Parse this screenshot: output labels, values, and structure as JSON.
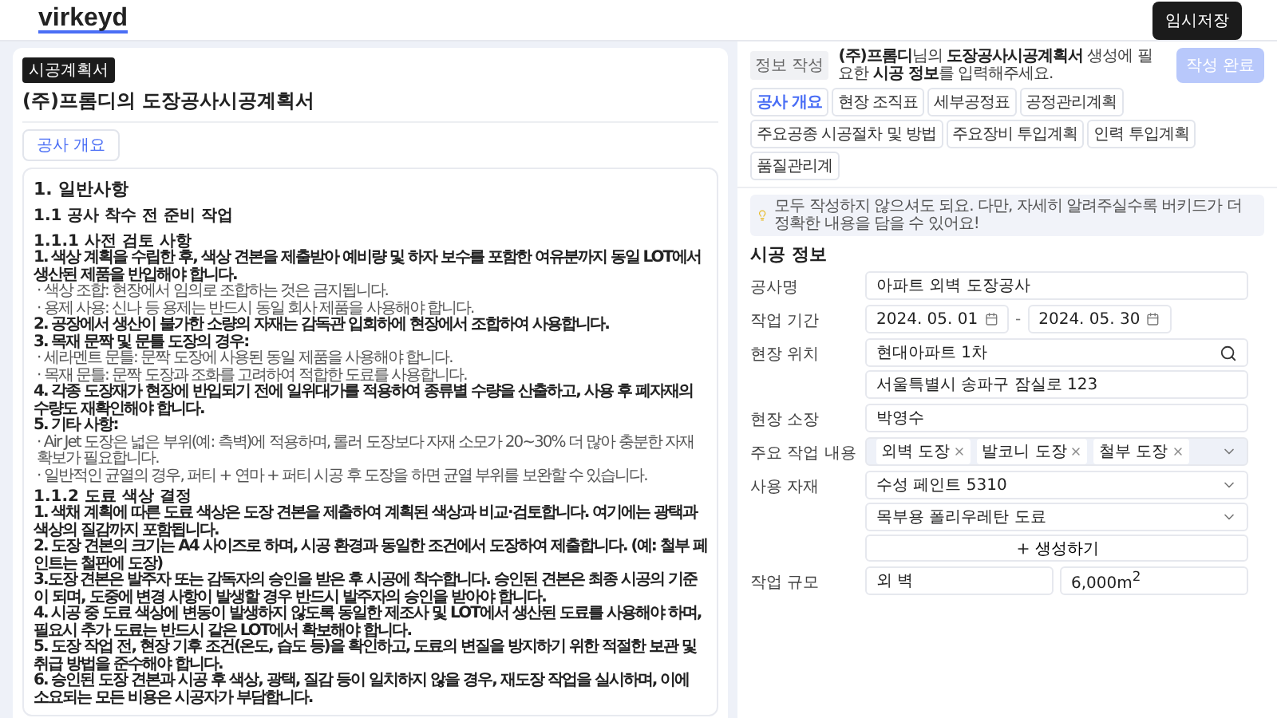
{
  "header": {
    "logo": "virkeyd",
    "save_button": "임시저장"
  },
  "document": {
    "badge": "시공계획서",
    "title": "(주)프롬디의 도장공사시공계획서",
    "section_button": "공사 개요",
    "heading": "1. 일반사항",
    "subheading": "1.1 공사 착수 전 준비 작업",
    "blocks": [
      {
        "title": "1.1.1 사전 검토 사항",
        "lines": [
          {
            "kind": "main",
            "text": "1. 색상 계획을 수립한 후, 색상 견본을 제출받아 예비량 및 하자 보수를 포함한 여유분까지 동일 LOT에서 생산된 제품을 반입해야 합니다."
          },
          {
            "kind": "sub",
            "text": "· 색상 조합: 현장에서 임의로 조합하는 것은 금지됩니다."
          },
          {
            "kind": "sub",
            "text": "· 용제 사용: 신나 등 용제는 반드시 동일 회사 제품을 사용해야 합니다."
          },
          {
            "kind": "main",
            "text": "2. 공장에서 생산이 불가한 소량의 자재는 감독관 입회하에 현장에서 조합하여 사용합니다."
          },
          {
            "kind": "main",
            "text": "3. 목재 문짝 및 문틀 도장의 경우:"
          },
          {
            "kind": "sub",
            "text": "· 세라멘트 문틀: 문짝 도장에 사용된 동일 제품을 사용해야 합니다."
          },
          {
            "kind": "sub",
            "text": "· 목재 문틀: 문짝 도장과 조화를 고려하여 적합한 도료를 사용합니다."
          },
          {
            "kind": "main",
            "text": "4. 각종 도장재가 현장에 반입되기 전에 일위대가를 적용하여 종류별 수량을 산출하고, 사용 후 폐자재의 수량도 재확인해야 합니다."
          },
          {
            "kind": "main",
            "text": "5. 기타 사항:"
          },
          {
            "kind": "sub",
            "text": "· Air Jet 도장은 넓은 부위(예: 측벽)에 적용하며, 롤러 도장보다 자재 소모가 20~30% 더 많아 충분한 자재 확보가 필요합니다."
          },
          {
            "kind": "sub",
            "text": "· 일반적인 균열의 경우, 퍼티 + 연마 + 퍼티 시공 후 도장을 하면 균열 부위를 보완할 수 있습니다."
          }
        ]
      },
      {
        "title": "1.1.2 도료 색상 결정",
        "lines": [
          {
            "kind": "main",
            "text": "1. 색채 계획에 따른 도료 색상은 도장 견본을 제출하여 계획된 색상과 비교·검토합니다. 여기에는 광택과 색상의 질감까지 포함됩니다."
          },
          {
            "kind": "main",
            "text": "2. 도장 견본의 크기는 A4 사이즈로 하며, 시공 환경과 동일한 조건에서 도장하여 제출합니다. (예: 철부 페인트는 철판에 도장)"
          },
          {
            "kind": "main",
            "text": "3.도장 견본은 발주자 또는 감독자의 승인을 받은 후 시공에 착수합니다. 승인된 견본은 최종 시공의 기준이 되며, 도중에 변경 사항이 발생할 경우 반드시 발주자의 승인을 받아야 합니다."
          },
          {
            "kind": "main",
            "text": "4. 시공 중 도료 색상에 변동이 발생하지 않도록 동일한 제조사 및 LOT에서 생산된 도료를 사용해야 하며, 필요시 추가 도료는 반드시 같은 LOT에서 확보해야 합니다."
          },
          {
            "kind": "main",
            "text": "5. 도장 작업 전, 현장 기후 조건(온도, 습도 등)을 확인하고, 도료의 변질을 방지하기 위한 적절한 보관 및 취급 방법을 준수해야 합니다."
          },
          {
            "kind": "main",
            "text": "6. 승인된 도장 견본과 시공 후 색상, 광택, 질감 등이 일치하지 않을 경우, 재도장 작업을 실시하며, 이에 소요되는 모든 비용은 시공자가 부담합니다."
          }
        ]
      }
    ]
  },
  "form": {
    "tag": "정보 작성",
    "intro": "**(주)프롬디**님의 **도장공사시공계획서** 생성에 필요한 **시공 정보**를 입력해주세요.",
    "submit": {
      "label": "작성 완료",
      "disabled": true
    },
    "tabs": [
      {
        "label": "공사 개요",
        "selected": true
      },
      {
        "label": "현장 조직표",
        "selected": false
      },
      {
        "label": "세부공정표",
        "selected": false
      },
      {
        "label": "공정관리계획",
        "selected": false
      },
      {
        "label": "주요공종 시공절차 및 방법",
        "selected": false
      },
      {
        "label": "주요장비 투입계획",
        "selected": false
      },
      {
        "label": "인력 투입계획",
        "selected": false
      },
      {
        "label": "품질관리계",
        "selected": false
      }
    ],
    "notice": "모두 작성하지 않으셔도 되요. 다만, 자세히 알려주실수록 버키드가 더 정확한 내용을 담을 수 있어요!",
    "section_title": "시공 정보",
    "rows": [
      {
        "kind": "text",
        "label": "공사명",
        "value": "아파트 외벽 도장공사"
      },
      {
        "kind": "dates",
        "label": "작업 기간",
        "start": "2024. 05. 01",
        "separator": "-",
        "end": "2024. 05. 30"
      },
      {
        "kind": "location",
        "label": "현장 위치",
        "search": "현대아파트 1차",
        "address": "서울특별시 송파구 잠실로 123"
      },
      {
        "kind": "text",
        "label": "현장 소장",
        "value": "박영수"
      },
      {
        "kind": "chips",
        "label": "주요 작업 내용",
        "chips": [
          "외벽 도장",
          "발코니 도장",
          "철부 도장"
        ]
      },
      {
        "kind": "selects",
        "label": "사용 자재",
        "options": [
          "수성 페인트 5310",
          "목부용 폴리우레탄 도료"
        ],
        "add_button": "생성하기"
      },
      {
        "kind": "pair",
        "label": "작업 규모",
        "values": [
          "외 벽",
          "6,000m$^{2}$"
        ]
      }
    ]
  }
}
